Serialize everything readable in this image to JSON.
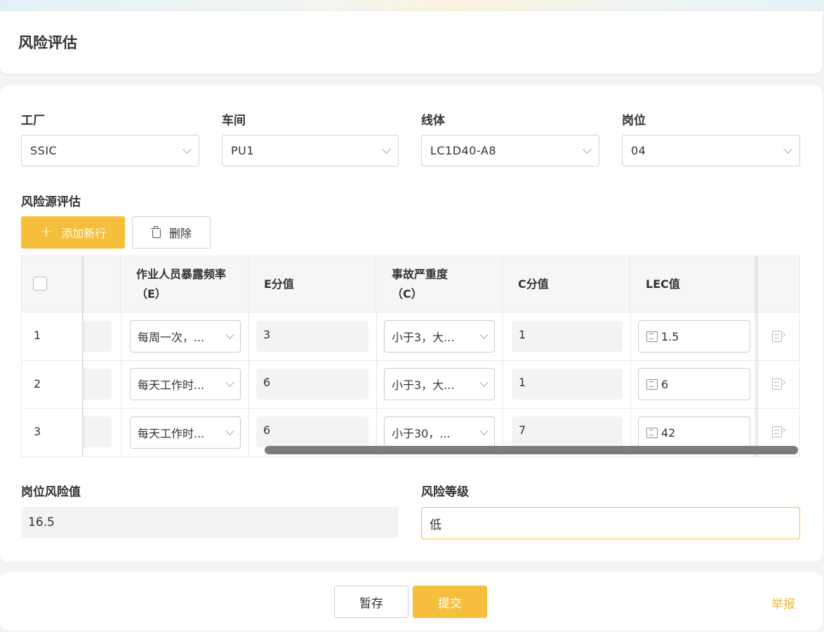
{
  "page": {
    "title": "风险评估"
  },
  "filters": {
    "factory": {
      "label": "工厂",
      "value": "SSIC"
    },
    "workshop": {
      "label": "车间",
      "value": "PU1"
    },
    "line": {
      "label": "线体",
      "value": "LC1D40-A8"
    },
    "post": {
      "label": "岗位",
      "value": "04"
    }
  },
  "risk_source": {
    "section_title": "风险源评估",
    "add_label": "添加新行",
    "delete_label": "删除",
    "columns": {
      "exposure": "作业人员暴露频率（E）",
      "e_score": "E分值",
      "severity": "事故严重度（C）",
      "c_score": "C分值",
      "lec": "LEC值"
    },
    "rows": [
      {
        "index": "1",
        "exposure": "每周一次，...",
        "e_score": "3",
        "severity": "小于3，大...",
        "c_score": "1",
        "lec": "1.5"
      },
      {
        "index": "2",
        "exposure": "每天工作时...",
        "e_score": "6",
        "severity": "小于3，大...",
        "c_score": "1",
        "lec": "6"
      },
      {
        "index": "3",
        "exposure": "每天工作时...",
        "e_score": "6",
        "severity": "小于30，...",
        "c_score": "7",
        "lec": "42"
      }
    ]
  },
  "summary": {
    "post_risk_label": "岗位风险值",
    "post_risk_value": "16.5",
    "risk_level_label": "风险等级",
    "risk_level_value": "低"
  },
  "footer": {
    "save_label": "暂存",
    "submit_label": "提交",
    "report_label": "举报"
  },
  "colors": {
    "accent": "#f5be3b",
    "link": "#f0b43a"
  }
}
